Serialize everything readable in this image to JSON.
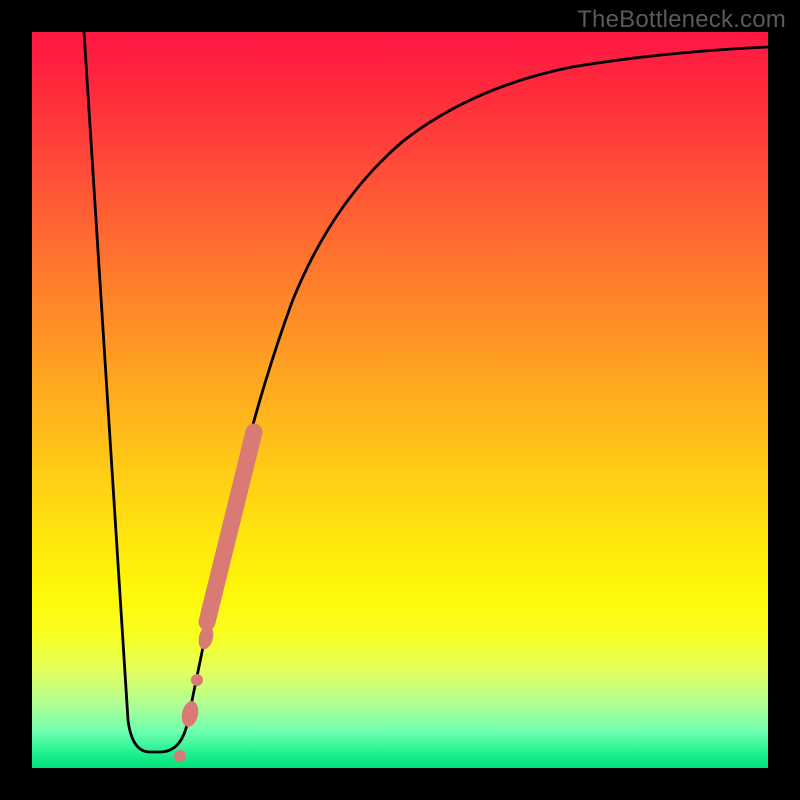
{
  "watermark": "TheBottleneck.com",
  "chart_data": {
    "type": "line",
    "title": "",
    "xlabel": "",
    "ylabel": "",
    "xlim": [
      0,
      100
    ],
    "ylim": [
      0,
      100
    ],
    "background_gradient": {
      "orientation": "vertical",
      "stops": [
        {
          "pos": 0.0,
          "color": "#ff1744"
        },
        {
          "pos": 0.18,
          "color": "#ff4a38"
        },
        {
          "pos": 0.38,
          "color": "#ff8a28"
        },
        {
          "pos": 0.58,
          "color": "#ffc717"
        },
        {
          "pos": 0.76,
          "color": "#fff808"
        },
        {
          "pos": 0.91,
          "color": "#b4ff90"
        },
        {
          "pos": 1.0,
          "color": "#00e078"
        }
      ]
    },
    "series": [
      {
        "name": "bottleneck-curve",
        "color": "#000000",
        "x": [
          7,
          13,
          16,
          17,
          21,
          23,
          27,
          35,
          50,
          73,
          100
        ],
        "y": [
          100,
          6.5,
          2.2,
          2.2,
          6.5,
          16,
          32,
          63,
          85,
          95,
          98
        ]
      }
    ],
    "markers": [
      {
        "x": 20.1,
        "y": 1.6,
        "r": 6,
        "color": "#d97a74"
      },
      {
        "x": 21.5,
        "y": 7.3,
        "r": 10,
        "color": "#d97a74"
      },
      {
        "x": 22.4,
        "y": 12.0,
        "r": 6,
        "color": "#d97a74"
      },
      {
        "x": 23.6,
        "y": 17.8,
        "r": 9,
        "color": "#d97a74"
      }
    ],
    "highlight_band": {
      "color": "#d97a74",
      "width": 17,
      "start": {
        "x": 23.8,
        "y": 19.8
      },
      "end": {
        "x": 30.2,
        "y": 45.7
      }
    },
    "annotations": []
  }
}
